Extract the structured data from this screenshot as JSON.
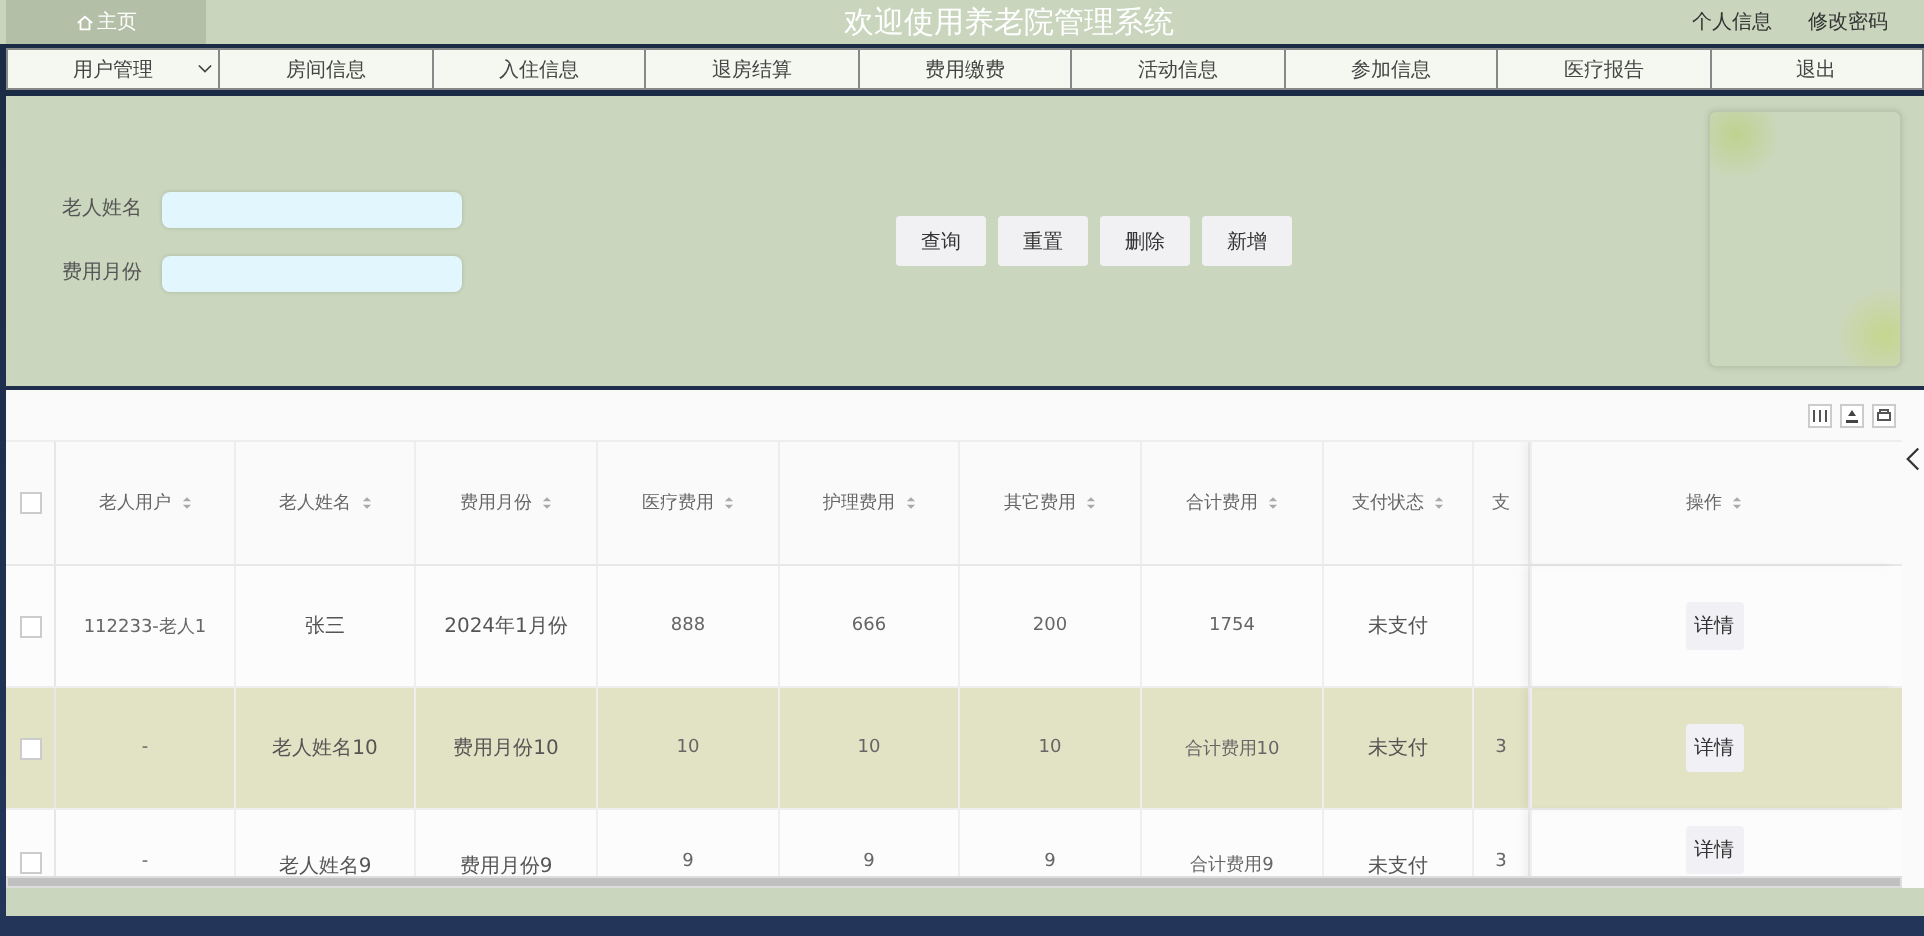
{
  "header": {
    "home": "主页",
    "title": "欢迎使用养老院管理系统",
    "links": [
      "个人信息",
      "修改密码"
    ]
  },
  "nav": [
    {
      "label": "用户管理",
      "dropdown": true
    },
    {
      "label": "房间信息",
      "dropdown": false
    },
    {
      "label": "入住信息",
      "dropdown": false
    },
    {
      "label": "退房结算",
      "dropdown": false
    },
    {
      "label": "费用缴费",
      "dropdown": false
    },
    {
      "label": "活动信息",
      "dropdown": false
    },
    {
      "label": "参加信息",
      "dropdown": false
    },
    {
      "label": "医疗报告",
      "dropdown": false
    },
    {
      "label": "退出",
      "dropdown": false
    }
  ],
  "search": {
    "fields": [
      {
        "label": "老人姓名"
      },
      {
        "label": "费用月份"
      }
    ],
    "buttons": [
      "查询",
      "重置",
      "删除",
      "新增"
    ]
  },
  "table": {
    "columns": [
      {
        "label": "老人用户",
        "sortable": true
      },
      {
        "label": "老人姓名",
        "sortable": true
      },
      {
        "label": "费用月份",
        "sortable": true
      },
      {
        "label": "医疗费用",
        "sortable": true
      },
      {
        "label": "护理费用",
        "sortable": true
      },
      {
        "label": "其它费用",
        "sortable": true
      },
      {
        "label": "合计费用",
        "sortable": true
      },
      {
        "label": "支付状态",
        "sortable": true
      },
      {
        "label": "支",
        "sortable": false
      }
    ],
    "action_column": {
      "label": "操作",
      "sortable": true
    },
    "select_all_checked": false,
    "rows": [
      {
        "highlighted": false,
        "checked": false,
        "cells": [
          "112233-老人1",
          "张三",
          "2024年1月份",
          "888",
          "666",
          "200",
          "1754",
          "未支付",
          ""
        ],
        "action": "详情"
      },
      {
        "highlighted": true,
        "checked": false,
        "cells": [
          "-",
          "老人姓名10",
          "费用月份10",
          "10",
          "10",
          "10",
          "合计费用10",
          "未支付",
          "3"
        ],
        "action": "详情"
      },
      {
        "highlighted": false,
        "checked": false,
        "cells": [
          "-",
          "老人姓名9",
          "费用月份9",
          "9",
          "9",
          "9",
          "合计费用9",
          "未支付",
          "3"
        ],
        "action": "详情"
      }
    ]
  }
}
